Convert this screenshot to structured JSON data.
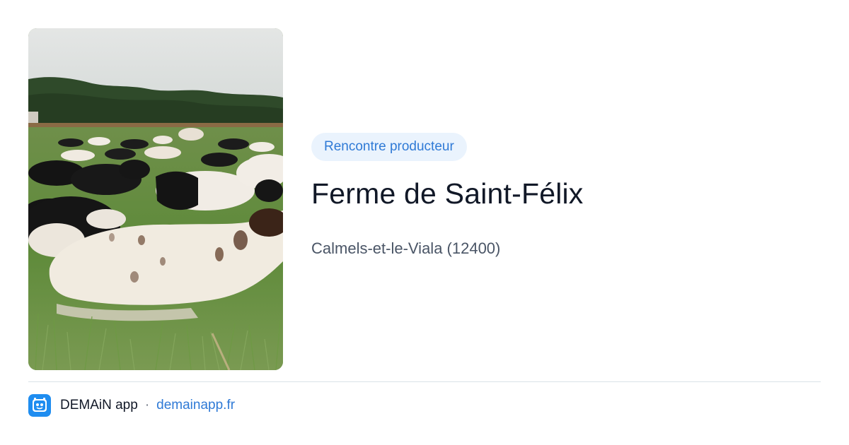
{
  "card": {
    "badge": "Rencontre producteur",
    "title": "Ferme de Saint-Félix",
    "location": "Calmels-et-le-Viala (12400)",
    "photo_icon": "cows-in-field-photo"
  },
  "footer": {
    "app_name": "DEMAiN app",
    "separator": "·",
    "domain": "demainapp.fr",
    "app_icon": "demain-app-icon"
  },
  "colors": {
    "accent": "#2f7ad6",
    "badge_bg": "#eaf3fd",
    "title": "#111827",
    "subtitle": "#4a5566",
    "app_icon_bg": "#1f8df0"
  }
}
